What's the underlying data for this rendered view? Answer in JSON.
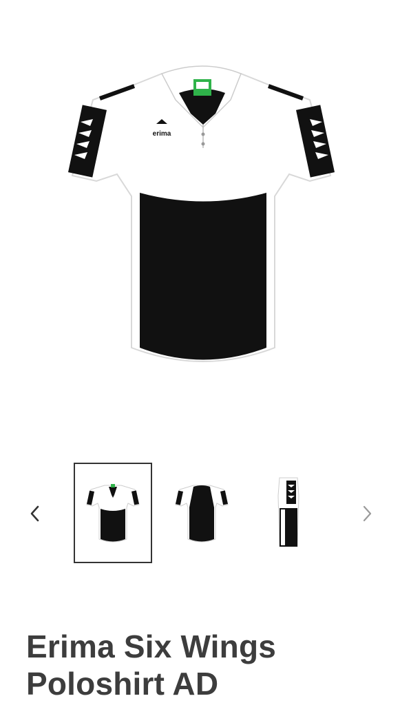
{
  "product": {
    "title": "Erima Six Wings Poloshirt AD",
    "brand_logo_text": "erima",
    "colors": {
      "primary": "#111111",
      "secondary": "#ffffff",
      "accent": "#2fb34a"
    }
  },
  "gallery": {
    "prev_icon": "chevron-left-icon",
    "next_icon": "chevron-right-icon",
    "selected_index": 0,
    "thumbnails": [
      {
        "view": "front"
      },
      {
        "view": "back"
      },
      {
        "view": "side"
      }
    ]
  },
  "text_colors": {
    "title": "#3d3d3d",
    "arrow_active": "#333333",
    "arrow_inactive": "#9a9a9a"
  }
}
